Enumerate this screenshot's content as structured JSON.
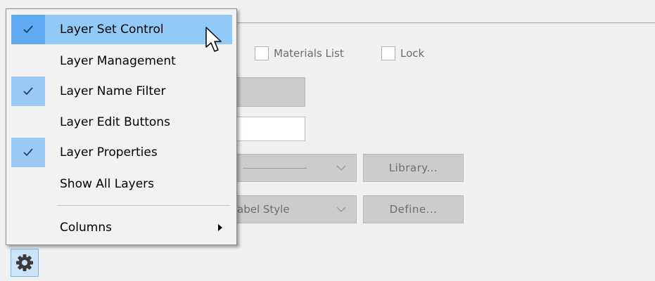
{
  "background_panel": {
    "checkboxes": [
      {
        "label": "Materials List",
        "checked": false
      },
      {
        "label": "Lock",
        "checked": false
      }
    ],
    "label_style_combo": {
      "value": "abel Style"
    },
    "buttons": {
      "library_label": "Library...",
      "define_label": "Define..."
    },
    "settings_icon": "gear-icon"
  },
  "context_menu": {
    "items": [
      {
        "label": "Layer Set Control",
        "checked": true,
        "highlighted": true
      },
      {
        "label": "Layer Management",
        "checked": false
      },
      {
        "label": "Layer Name Filter",
        "checked": true
      },
      {
        "label": "Layer Edit Buttons",
        "checked": false
      },
      {
        "label": "Layer Properties",
        "checked": true
      },
      {
        "label": "Show All Layers",
        "checked": false
      },
      {
        "label": "Columns",
        "checked": false,
        "submenu": true
      }
    ]
  },
  "colors": {
    "highlight": "#91c9f7",
    "check_column": "#99c9f4",
    "disabled_field": "#cccccc"
  }
}
